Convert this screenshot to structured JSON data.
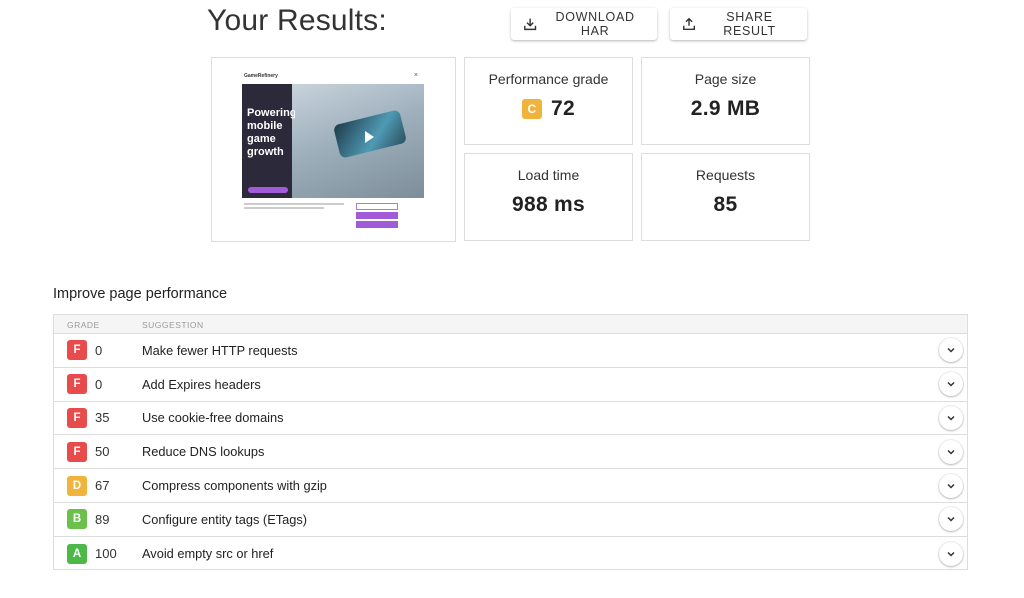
{
  "header": {
    "title": "Your Results:",
    "download_label": "DOWNLOAD HAR",
    "share_label": "SHARE RESULT"
  },
  "screenshot": {
    "logo_text": "GameRefinery",
    "headline": "Powering mobile game growth"
  },
  "metrics": {
    "performance": {
      "label": "Performance grade",
      "grade": "C",
      "value": "72"
    },
    "page_size": {
      "label": "Page size",
      "value": "2.9 MB"
    },
    "load_time": {
      "label": "Load time",
      "value": "988 ms"
    },
    "requests": {
      "label": "Requests",
      "value": "85"
    }
  },
  "improve": {
    "title": "Improve page performance",
    "columns": {
      "grade": "GRADE",
      "suggestion": "SUGGESTION"
    },
    "rows": [
      {
        "grade": "F",
        "score": "0",
        "suggestion": "Make fewer HTTP requests",
        "color": "#e84b4b"
      },
      {
        "grade": "F",
        "score": "0",
        "suggestion": "Add Expires headers",
        "color": "#e84b4b"
      },
      {
        "grade": "F",
        "score": "35",
        "suggestion": "Use cookie-free domains",
        "color": "#e84b4b"
      },
      {
        "grade": "F",
        "score": "50",
        "suggestion": "Reduce DNS lookups",
        "color": "#e84b4b"
      },
      {
        "grade": "D",
        "score": "67",
        "suggestion": "Compress components with gzip",
        "color": "#f0b43c"
      },
      {
        "grade": "B",
        "score": "89",
        "suggestion": "Configure entity tags (ETags)",
        "color": "#6cc04a"
      },
      {
        "grade": "A",
        "score": "100",
        "suggestion": "Avoid empty src or href",
        "color": "#4cb847"
      }
    ]
  },
  "colors": {
    "grade_c": "#f0b43c"
  }
}
